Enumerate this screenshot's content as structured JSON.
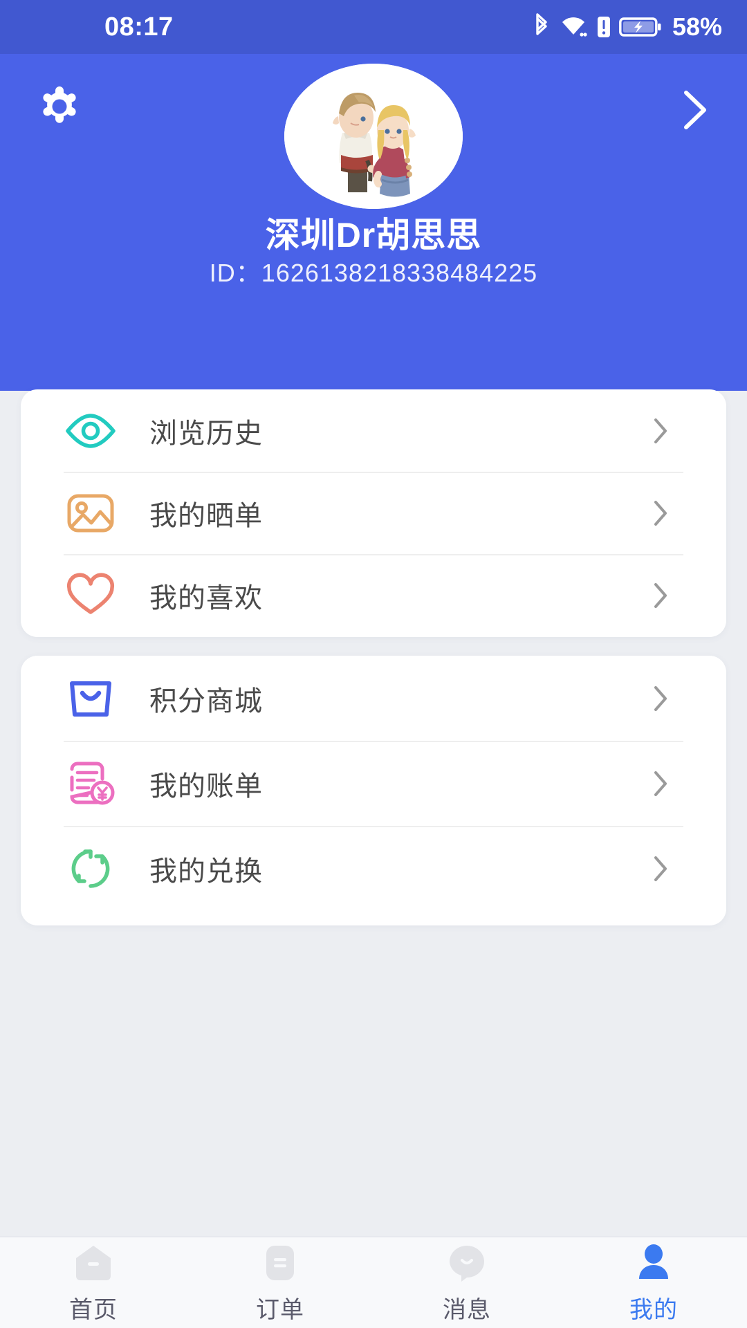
{
  "status_bar": {
    "time": "08:17",
    "battery_percent": "58%",
    "icons": [
      "bluetooth-icon",
      "wifi-icon",
      "sim-alert-icon",
      "battery-charging-icon"
    ]
  },
  "header": {
    "settings_icon": "gear-icon",
    "forward_icon": "chevron-right-icon",
    "avatar_alt": "user-avatar-anime-couple",
    "username": "深圳Dr胡思思",
    "id_label": "ID：",
    "id_value": "1626138218338484225",
    "background_color": "#4a62e8"
  },
  "cards": [
    {
      "name": "activity-card",
      "rows": [
        {
          "label": "浏览历史",
          "icon": "eye-icon",
          "color": "#22cbc0"
        },
        {
          "label": "我的晒单",
          "icon": "image-icon",
          "color": "#e8a866"
        },
        {
          "label": "我的喜欢",
          "icon": "heart-icon",
          "color": "#ec8370"
        }
      ]
    },
    {
      "name": "points-card",
      "rows": [
        {
          "label": "积分商城",
          "icon": "shopping-bag-icon",
          "color": "#4a62e8"
        },
        {
          "label": "我的账单",
          "icon": "bill-yuan-icon",
          "color": "#ec6fc0"
        },
        {
          "label": "我的兑换",
          "icon": "exchange-refresh-icon",
          "color": "#5ccd8a"
        }
      ]
    }
  ],
  "row_chevron_icon": "chevron-right-icon",
  "tabbar": {
    "active_color": "#3b7af0",
    "inactive_color": "#5a5a6b",
    "items": [
      {
        "label": "首页",
        "icon": "home-icon",
        "active": false
      },
      {
        "label": "订单",
        "icon": "order-list-icon",
        "active": false
      },
      {
        "label": "消息",
        "icon": "message-icon",
        "active": false
      },
      {
        "label": "我的",
        "icon": "person-icon",
        "active": true
      }
    ]
  }
}
